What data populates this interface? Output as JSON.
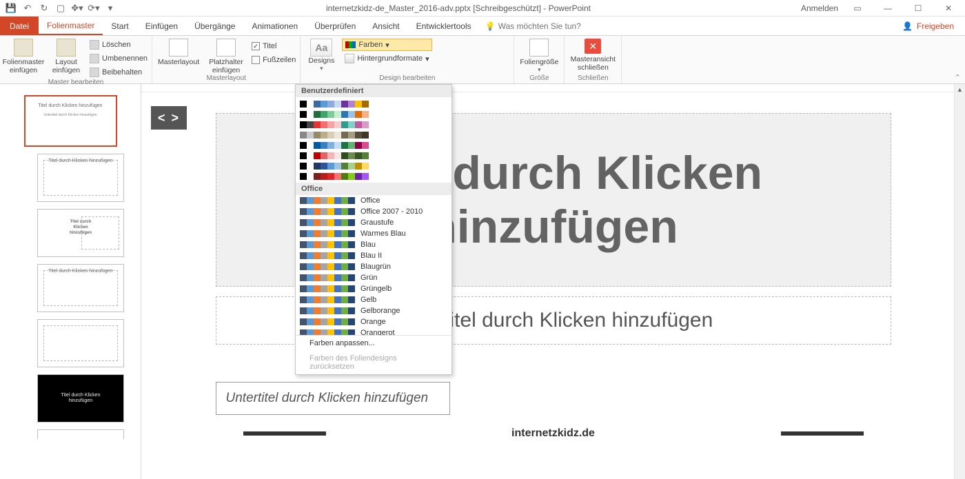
{
  "titlebar": {
    "document_title": "internetzkidz-de_Master_2016-adv.pptx [Schreibgeschützt] - PowerPoint",
    "account": "Anmelden"
  },
  "tabs": {
    "file": "Datei",
    "items": [
      "Folienmaster",
      "Start",
      "Einfügen",
      "Übergänge",
      "Animationen",
      "Überprüfen",
      "Ansicht",
      "Entwicklertools"
    ],
    "tell_me_placeholder": "Was möchten Sie tun?",
    "share": "Freigeben"
  },
  "ribbon": {
    "master_edit": {
      "insert_master": "Folienmaster\neinfügen",
      "insert_layout": "Layout\neinfügen",
      "delete": "Löschen",
      "rename": "Umbenennen",
      "preserve": "Beibehalten",
      "group_label": "Master bearbeiten"
    },
    "master_layout_group": {
      "master_layout": "Masterlayout",
      "placeholder": "Platzhalter\neinfügen",
      "title_chk": "Titel",
      "footers_chk": "Fußzeilen",
      "group_label": "Masterlayout"
    },
    "edit_design": {
      "designs": "Designs",
      "colors": "Farben",
      "bg_formats": "Hintergrundformate",
      "group_label": "Design bearbeiten"
    },
    "size": {
      "btn": "Foliengröße",
      "group_label": "Größe"
    },
    "close": {
      "btn": "Masteransicht\nschließen",
      "group_label": "Schließen"
    }
  },
  "dropdown": {
    "section_custom": "Benutzerdefiniert",
    "section_office": "Office",
    "themes": [
      "Office",
      "Office 2007 - 2010",
      "Graustufe",
      "Warmes Blau",
      "Blau",
      "Blau II",
      "Blaugrün",
      "Grün",
      "Grüngelb",
      "Gelb",
      "Gelborange",
      "Orange",
      "Orangerot"
    ],
    "customize": "Farben anpassen...",
    "reset": "Farben des Foliendesigns zurücksetzen"
  },
  "thumbs": {
    "master_title": "Titel durch Klicken hinzufügen",
    "layout_title": "Titel durch Klicken hinzufügen"
  },
  "slide": {
    "title_ph": "Titel durch Klicken hinzufügen",
    "visible_title_fragment": "Titel durch Klicken hinzufügen",
    "subtitle_ph": "Untertitel durch Klicken hinzufügen",
    "subtitle2_ph": "Untertitel durch Klicken hinzufügen",
    "footer_brand": "internetzkidz.de"
  },
  "swatch_palettes": {
    "custom": [
      [
        "#000",
        "#fff",
        "#3b6aa0",
        "#5b9bd5",
        "#8faadc",
        "#c5d9f1",
        "#7030a0",
        "#b084cc",
        "#ffc000",
        "#a26b00"
      ],
      [
        "#000",
        "#fff",
        "#1f6f3e",
        "#3fa66b",
        "#7ecb98",
        "#c6efce",
        "#2e75b6",
        "#9bc2e6",
        "#e26b0a",
        "#f4b183"
      ],
      [
        "#000",
        "#444",
        "#e43333",
        "#ef6e6e",
        "#f5a3a3",
        "#f8cccc",
        "#2e9c8e",
        "#7fd1c7",
        "#c05ba0",
        "#d89bc3"
      ],
      [
        "#888",
        "#c9c9c9",
        "#968a6d",
        "#bcae89",
        "#d7ceb4",
        "#ece7d8",
        "#726a55",
        "#a79d80",
        "#554e3b",
        "#3b3625"
      ],
      [
        "#000",
        "#fff",
        "#005a9e",
        "#3a7fbf",
        "#7fb1df",
        "#c3ddf3",
        "#1e7145",
        "#60b36f",
        "#8c004b",
        "#d74b8f"
      ],
      [
        "#000",
        "#fff",
        "#c00000",
        "#e06666",
        "#f4b6b6",
        "#fbe4e4",
        "#2e4e1f",
        "#6b8e4e",
        "#385723",
        "#548235"
      ],
      [
        "#000",
        "#fff",
        "#203864",
        "#2f5597",
        "#5b9bd5",
        "#9dc3e6",
        "#548235",
        "#a9d18e",
        "#bf9000",
        "#ffd966"
      ],
      [
        "#000",
        "#fff",
        "#7f1d1d",
        "#b91c1c",
        "#dc2626",
        "#f87171",
        "#4d7c0f",
        "#84cc16",
        "#6b21a8",
        "#a855f7"
      ]
    ],
    "office_preview": [
      "#44546a",
      "#5b9bd5",
      "#ed7d31",
      "#a5a5a5",
      "#ffc000",
      "#4472c4",
      "#70ad47",
      "#264478"
    ]
  }
}
